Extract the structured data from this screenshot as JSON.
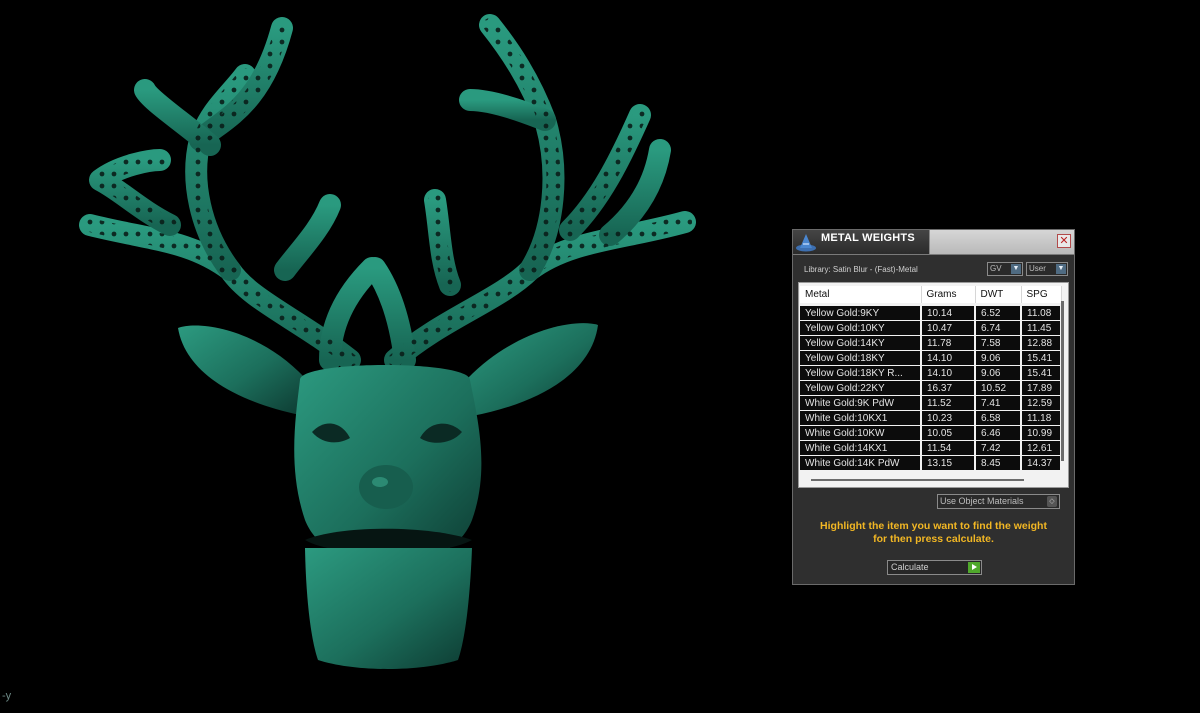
{
  "viewport": {
    "axis_label": "-y"
  },
  "panel": {
    "title": "METAL WEIGHTS",
    "close_glyph": "✕",
    "icon": "wizard-hat-icon",
    "library_label": "Library: Satin Blur - (Fast)-Metal",
    "units_select": "GV",
    "user_select": "User",
    "table": {
      "columns": [
        "Metal",
        "Grams",
        "DWT",
        "SPG"
      ],
      "rows": [
        [
          "Yellow Gold:9KY",
          "10.14",
          "6.52",
          "11.08"
        ],
        [
          "Yellow Gold:10KY",
          "10.47",
          "6.74",
          "11.45"
        ],
        [
          "Yellow Gold:14KY",
          "11.78",
          "7.58",
          "12.88"
        ],
        [
          "Yellow Gold:18KY",
          "14.10",
          "9.06",
          "15.41"
        ],
        [
          "Yellow Gold:18KY R...",
          "14.10",
          "9.06",
          "15.41"
        ],
        [
          "Yellow Gold:22KY",
          "16.37",
          "10.52",
          "17.89"
        ],
        [
          "White Gold:9K PdW",
          "11.52",
          "7.41",
          "12.59"
        ],
        [
          "White Gold:10KX1",
          "10.23",
          "6.58",
          "11.18"
        ],
        [
          "White Gold:10KW",
          "10.05",
          "6.46",
          "10.99"
        ],
        [
          "White Gold:14KX1",
          "11.54",
          "7.42",
          "12.61"
        ],
        [
          "White Gold:14K PdW",
          "13.15",
          "8.45",
          "14.37"
        ]
      ]
    },
    "materials_select": "Use Object Materials",
    "instruction_line1": "Highlight the item you want to find the weight",
    "instruction_line2": "for then press calculate.",
    "calculate_label": "Calculate"
  },
  "colors": {
    "model": "#1f7a66",
    "instruction": "#f2b724",
    "accent": "#4f6b82",
    "go": "#4fa82b"
  }
}
